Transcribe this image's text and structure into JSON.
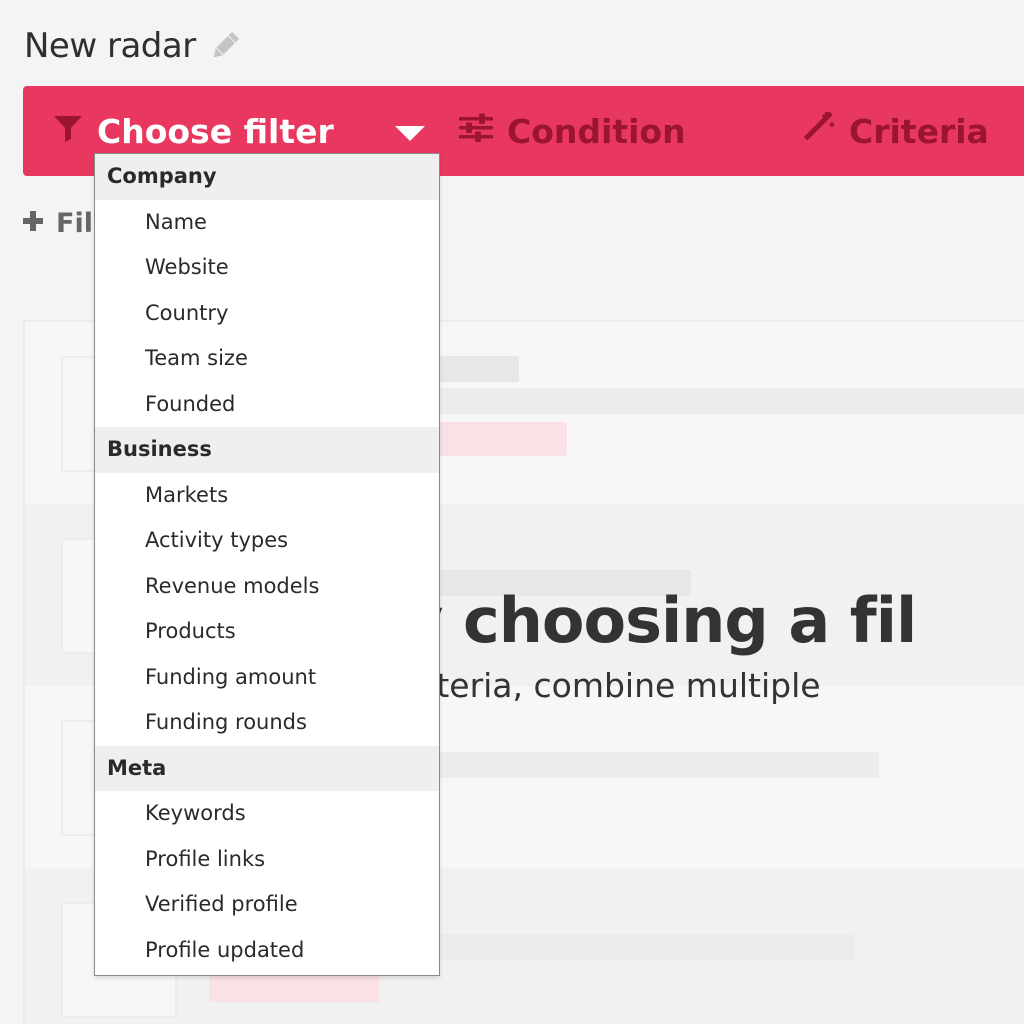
{
  "page": {
    "title": "New radar"
  },
  "filter_bar": {
    "choose_label": "Choose filter",
    "condition_label": "Condition",
    "criteria_label": "Criteria",
    "accent_color": "#e8385f",
    "inactive_text_color": "#9b1530"
  },
  "add_filter_label": "Fil",
  "empty_state": {
    "title": "art by choosing a fil",
    "subtitle": "ition and criteria, combine multiple"
  },
  "dropdown": {
    "groups": [
      {
        "header": "Company",
        "items": [
          "Name",
          "Website",
          "Country",
          "Team size",
          "Founded"
        ]
      },
      {
        "header": "Business",
        "items": [
          "Markets",
          "Activity types",
          "Revenue models",
          "Products",
          "Funding amount",
          "Funding rounds"
        ]
      },
      {
        "header": "Meta",
        "items": [
          "Keywords",
          "Profile links",
          "Verified profile",
          "Profile updated"
        ]
      }
    ]
  },
  "icons": {
    "title_edit": "pencil-icon",
    "choose": "filter-funnel-icon",
    "condition": "sliders-icon",
    "criteria": "magic-wand-icon",
    "add": "plus-icon",
    "toggle": "caret-down-icon"
  }
}
